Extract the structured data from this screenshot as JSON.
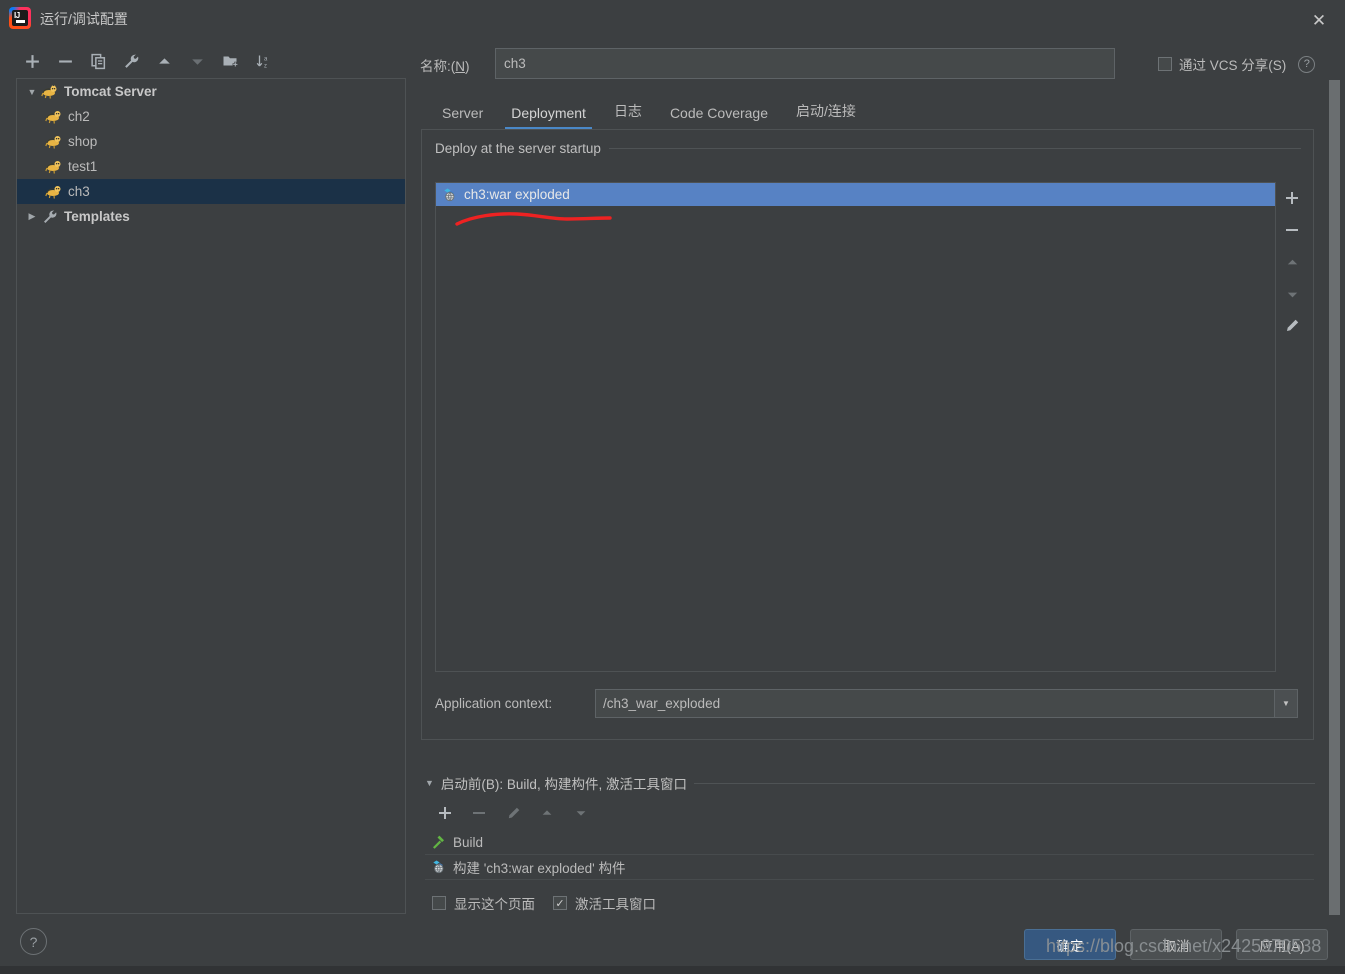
{
  "window": {
    "title": "运行/调试配置",
    "app_icon": "intellij-idea-logo",
    "close_icon": "close-icon"
  },
  "left_toolbar": {
    "buttons": [
      {
        "name": "add",
        "icon": "plus-icon",
        "enabled": true
      },
      {
        "name": "remove",
        "icon": "minus-icon",
        "enabled": true
      },
      {
        "name": "copy",
        "icon": "copy-icon",
        "enabled": true
      },
      {
        "name": "edit-templates",
        "icon": "wrench-icon",
        "enabled": true
      },
      {
        "name": "move-up",
        "icon": "arrow-up-icon",
        "enabled": true
      },
      {
        "name": "move-down",
        "icon": "arrow-down-icon",
        "enabled": false
      },
      {
        "name": "new-folder",
        "icon": "folder-add-icon",
        "enabled": true
      },
      {
        "name": "sort-alphabetically",
        "icon": "sort-az-icon",
        "enabled": true
      }
    ]
  },
  "tree": {
    "nodes": [
      {
        "label": "Tomcat Server",
        "icon": "tomcat-icon",
        "expanded": true,
        "level": 0,
        "bold": true,
        "selected": false
      },
      {
        "label": "ch2",
        "icon": "tomcat-icon",
        "level": 1,
        "bold": false,
        "selected": false
      },
      {
        "label": "shop",
        "icon": "tomcat-icon",
        "level": 1,
        "bold": false,
        "selected": false
      },
      {
        "label": "test1",
        "icon": "tomcat-icon",
        "level": 1,
        "bold": false,
        "selected": false
      },
      {
        "label": "ch3",
        "icon": "tomcat-icon",
        "level": 1,
        "bold": false,
        "selected": true
      },
      {
        "label": "Templates",
        "icon": "wrench-icon",
        "expanded": false,
        "level": 0,
        "bold": true,
        "selected": false
      }
    ]
  },
  "help_button": {
    "label": "?",
    "icon": "question-mark-icon"
  },
  "name_field": {
    "label_prefix": "名称:(",
    "label_mnemonic": "N",
    "label_suffix": ")",
    "value": "ch3",
    "placeholder": ""
  },
  "share_vcs": {
    "checked": false,
    "label": "通过 VCS 分享(S)",
    "help_icon": "question-mark-icon"
  },
  "tabs": [
    {
      "label": "Server",
      "active": false
    },
    {
      "label": "Deployment",
      "active": true
    },
    {
      "label": "日志",
      "active": false
    },
    {
      "label": "Code Coverage",
      "active": false
    },
    {
      "label": "启动/连接",
      "active": false
    }
  ],
  "deployment": {
    "group_title": "Deploy at the server startup",
    "items": [
      {
        "label": "ch3:war exploded",
        "icon": "artifact-icon",
        "selected": true
      }
    ],
    "side_buttons": [
      {
        "name": "add-artifact",
        "icon": "plus-icon",
        "enabled": true
      },
      {
        "name": "remove-artifact",
        "icon": "minus-icon",
        "enabled": true
      },
      {
        "name": "move-artifact-up",
        "icon": "arrow-up-icon",
        "enabled": false
      },
      {
        "name": "move-artifact-down",
        "icon": "arrow-down-icon",
        "enabled": false
      },
      {
        "name": "edit-artifact",
        "icon": "pencil-icon",
        "enabled": true
      }
    ],
    "application_context": {
      "label": "Application context:",
      "value": "/ch3_war_exploded",
      "dropdown_icon": "chevron-down-icon"
    }
  },
  "before_launch": {
    "expanded": true,
    "title": "启动前(B): Build, 构建构件, 激活工具窗口",
    "toolbar": [
      {
        "name": "add-task",
        "icon": "plus-icon",
        "enabled": true
      },
      {
        "name": "remove-task",
        "icon": "minus-icon",
        "enabled": false
      },
      {
        "name": "edit-task",
        "icon": "pencil-icon",
        "enabled": false
      },
      {
        "name": "task-up",
        "icon": "arrow-up-icon",
        "enabled": false
      },
      {
        "name": "task-down",
        "icon": "arrow-down-icon",
        "enabled": false
      }
    ],
    "tasks": [
      {
        "label": "Build",
        "icon": "hammer-icon"
      },
      {
        "label": "构建 'ch3:war exploded' 构件",
        "icon": "artifact-icon"
      }
    ],
    "options": [
      {
        "label": "显示这个页面",
        "checked": false
      },
      {
        "label": "激活工具窗口",
        "checked": true
      }
    ]
  },
  "footer": {
    "ok": "确定",
    "cancel": "取消",
    "apply": "应用(A)"
  },
  "watermark": "https://blog.csdn.net/x2425970538",
  "colors": {
    "background": "#3c3f41",
    "panel_border": "#4e5254",
    "selection_blue": "#5782c4",
    "tree_selection": "#1b3147",
    "tab_underline": "#4a88c7",
    "primary_button": "#365880",
    "annotation_red": "#ee2222",
    "text": "#bbbbbb"
  }
}
